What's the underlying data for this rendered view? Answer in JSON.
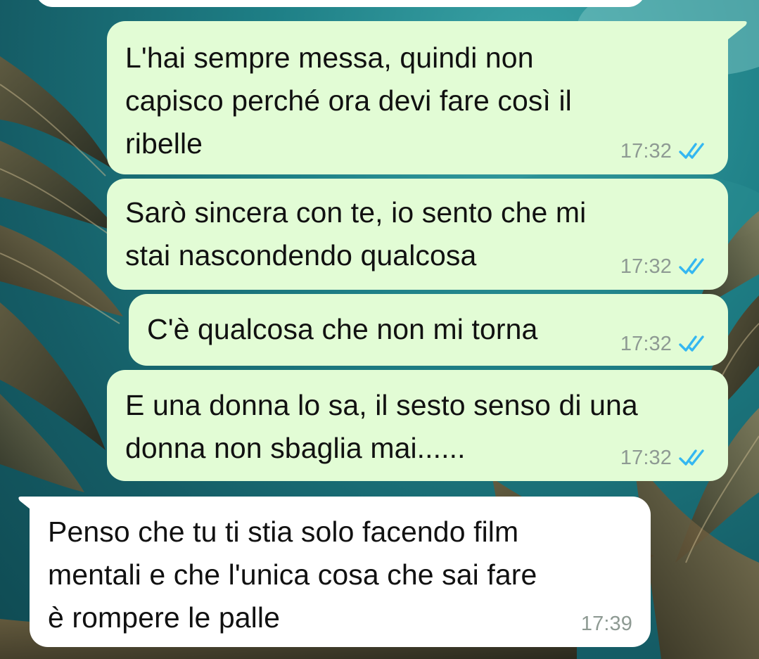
{
  "theme": {
    "outgoing_bubble": "#e2fcd5",
    "incoming_bubble": "#ffffff",
    "read_tick_color": "#34b7f1",
    "timestamp_color": "#8e9a93"
  },
  "messages": [
    {
      "direction": "outgoing",
      "text": "L'hai sempre messa, quindi non\ncapisco perché ora devi fare così il\nribelle",
      "time": "17:32",
      "status": "read",
      "status_icon": "double-check-icon"
    },
    {
      "direction": "outgoing",
      "text": "Sarò sincera con te, io sento che mi\nstai nascondendo qualcosa",
      "time": "17:32",
      "status": "read",
      "status_icon": "double-check-icon"
    },
    {
      "direction": "outgoing",
      "text": "C'è qualcosa che non mi torna",
      "time": "17:32",
      "status": "read",
      "status_icon": "double-check-icon"
    },
    {
      "direction": "outgoing",
      "text": "E una donna lo sa, il sesto senso di una\ndonna non sbaglia mai......",
      "time": "17:32",
      "status": "read",
      "status_icon": "double-check-icon"
    },
    {
      "direction": "incoming",
      "text": "Penso che tu ti stia solo facendo film\nmentali e che l'unica cosa che sai fare\nè rompere le palle",
      "time": "17:39"
    }
  ]
}
